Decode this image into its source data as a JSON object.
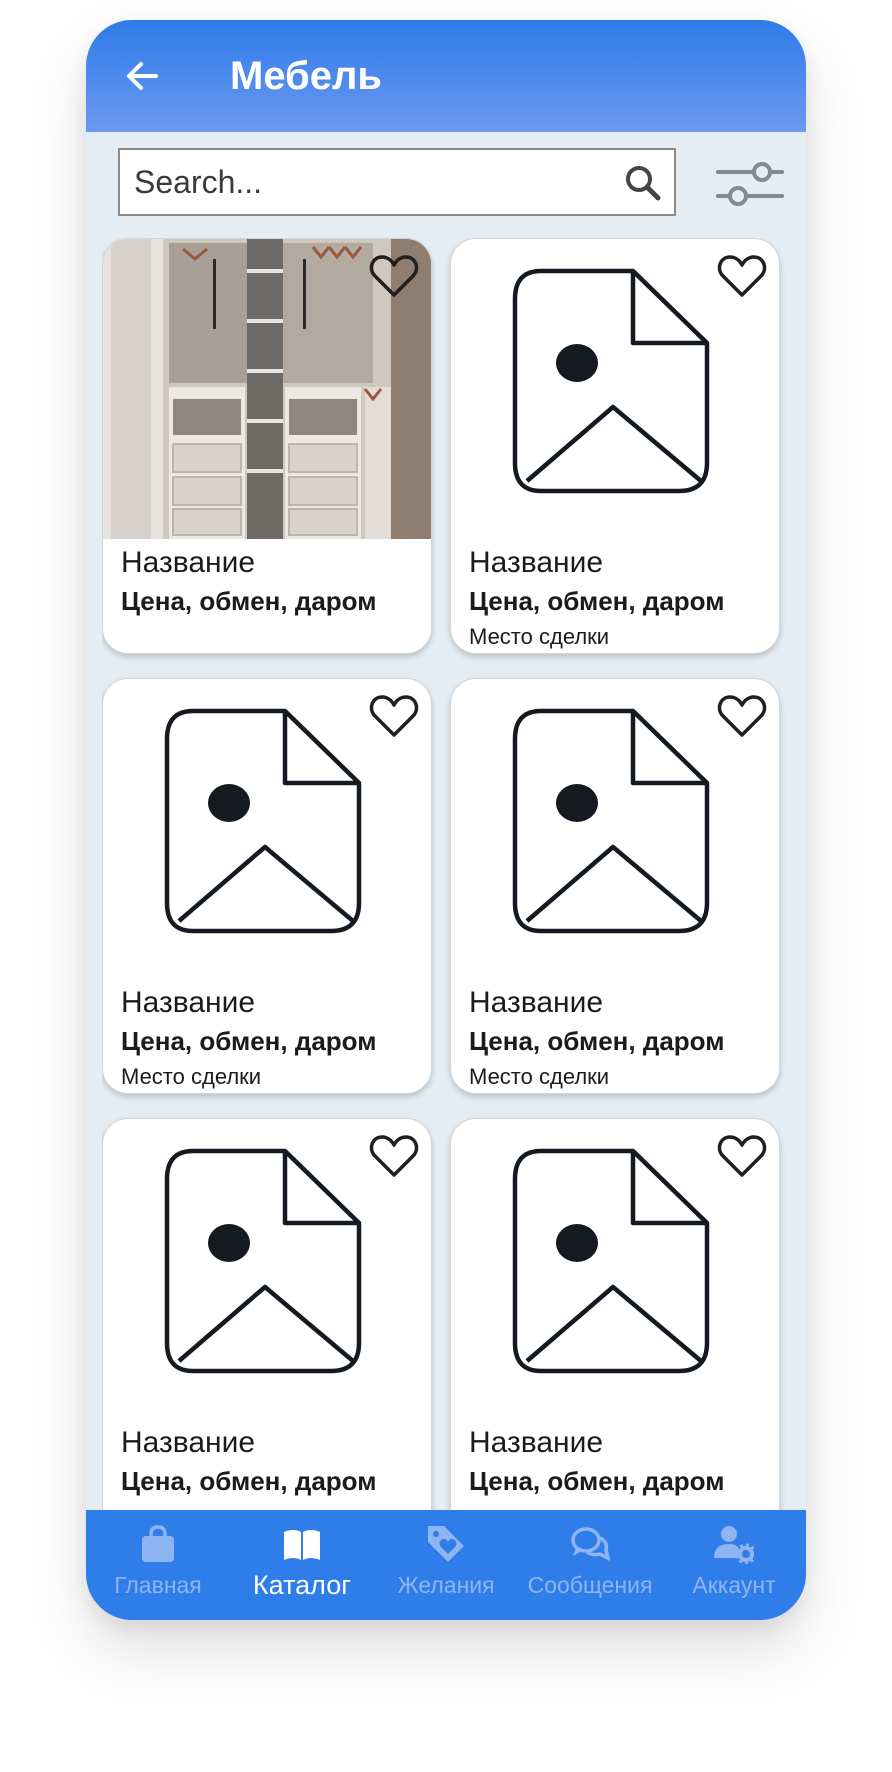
{
  "header": {
    "title": "Мебель"
  },
  "search": {
    "placeholder": "Search..."
  },
  "cards": [
    {
      "name": "Название",
      "price": "Цена, обмен, даром",
      "place": "",
      "has_photo": true
    },
    {
      "name": "Название",
      "price": "Цена, обмен, даром",
      "place": "Место сделки",
      "has_photo": false
    },
    {
      "name": "Название",
      "price": "Цена, обмен, даром",
      "place": "Место сделки",
      "has_photo": false
    },
    {
      "name": "Название",
      "price": "Цена, обмен, даром",
      "place": "Место сделки",
      "has_photo": false
    },
    {
      "name": "Название",
      "price": "Цена, обмен, даром",
      "place": "",
      "has_photo": false
    },
    {
      "name": "Название",
      "price": "Цена, обмен, даром",
      "place": "",
      "has_photo": false
    }
  ],
  "nav": {
    "items": [
      {
        "label": "Главная",
        "icon": "shopping-bag-icon",
        "active": false
      },
      {
        "label": "Каталог",
        "icon": "book-icon",
        "active": true
      },
      {
        "label": "Желания",
        "icon": "heart-tag-icon",
        "active": false
      },
      {
        "label": "Сообщения",
        "icon": "chat-bubbles-icon",
        "active": false
      },
      {
        "label": "Аккаунт",
        "icon": "user-settings-icon",
        "active": false
      }
    ]
  },
  "colors": {
    "header_gradient_top": "#2e7be8",
    "header_gradient_bottom": "#6b99f0",
    "nav_background": "#2f7de9",
    "nav_inactive": "#8eb4f2",
    "nav_active": "#ffffff",
    "page_background": "#e3edf3"
  }
}
